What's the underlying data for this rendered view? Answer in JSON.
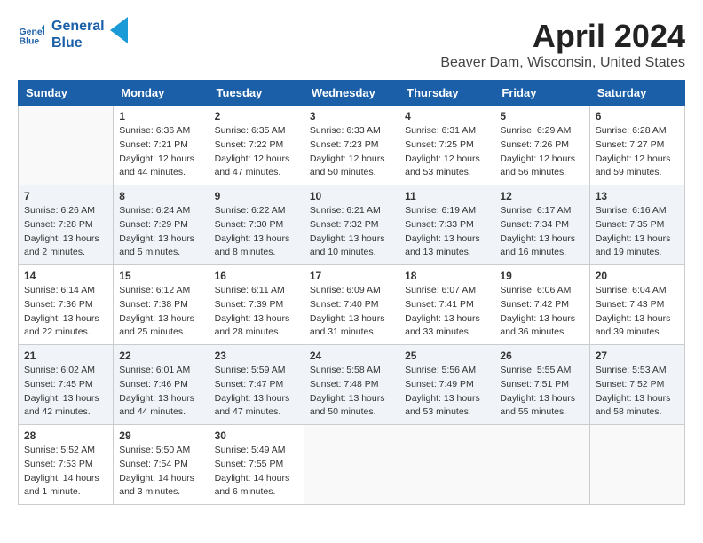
{
  "header": {
    "logo_line1": "General",
    "logo_line2": "Blue",
    "month": "April 2024",
    "location": "Beaver Dam, Wisconsin, United States"
  },
  "weekdays": [
    "Sunday",
    "Monday",
    "Tuesday",
    "Wednesday",
    "Thursday",
    "Friday",
    "Saturday"
  ],
  "weeks": [
    [
      {
        "day": "",
        "info": ""
      },
      {
        "day": "1",
        "info": "Sunrise: 6:36 AM\nSunset: 7:21 PM\nDaylight: 12 hours\nand 44 minutes."
      },
      {
        "day": "2",
        "info": "Sunrise: 6:35 AM\nSunset: 7:22 PM\nDaylight: 12 hours\nand 47 minutes."
      },
      {
        "day": "3",
        "info": "Sunrise: 6:33 AM\nSunset: 7:23 PM\nDaylight: 12 hours\nand 50 minutes."
      },
      {
        "day": "4",
        "info": "Sunrise: 6:31 AM\nSunset: 7:25 PM\nDaylight: 12 hours\nand 53 minutes."
      },
      {
        "day": "5",
        "info": "Sunrise: 6:29 AM\nSunset: 7:26 PM\nDaylight: 12 hours\nand 56 minutes."
      },
      {
        "day": "6",
        "info": "Sunrise: 6:28 AM\nSunset: 7:27 PM\nDaylight: 12 hours\nand 59 minutes."
      }
    ],
    [
      {
        "day": "7",
        "info": "Sunrise: 6:26 AM\nSunset: 7:28 PM\nDaylight: 13 hours\nand 2 minutes."
      },
      {
        "day": "8",
        "info": "Sunrise: 6:24 AM\nSunset: 7:29 PM\nDaylight: 13 hours\nand 5 minutes."
      },
      {
        "day": "9",
        "info": "Sunrise: 6:22 AM\nSunset: 7:30 PM\nDaylight: 13 hours\nand 8 minutes."
      },
      {
        "day": "10",
        "info": "Sunrise: 6:21 AM\nSunset: 7:32 PM\nDaylight: 13 hours\nand 10 minutes."
      },
      {
        "day": "11",
        "info": "Sunrise: 6:19 AM\nSunset: 7:33 PM\nDaylight: 13 hours\nand 13 minutes."
      },
      {
        "day": "12",
        "info": "Sunrise: 6:17 AM\nSunset: 7:34 PM\nDaylight: 13 hours\nand 16 minutes."
      },
      {
        "day": "13",
        "info": "Sunrise: 6:16 AM\nSunset: 7:35 PM\nDaylight: 13 hours\nand 19 minutes."
      }
    ],
    [
      {
        "day": "14",
        "info": "Sunrise: 6:14 AM\nSunset: 7:36 PM\nDaylight: 13 hours\nand 22 minutes."
      },
      {
        "day": "15",
        "info": "Sunrise: 6:12 AM\nSunset: 7:38 PM\nDaylight: 13 hours\nand 25 minutes."
      },
      {
        "day": "16",
        "info": "Sunrise: 6:11 AM\nSunset: 7:39 PM\nDaylight: 13 hours\nand 28 minutes."
      },
      {
        "day": "17",
        "info": "Sunrise: 6:09 AM\nSunset: 7:40 PM\nDaylight: 13 hours\nand 31 minutes."
      },
      {
        "day": "18",
        "info": "Sunrise: 6:07 AM\nSunset: 7:41 PM\nDaylight: 13 hours\nand 33 minutes."
      },
      {
        "day": "19",
        "info": "Sunrise: 6:06 AM\nSunset: 7:42 PM\nDaylight: 13 hours\nand 36 minutes."
      },
      {
        "day": "20",
        "info": "Sunrise: 6:04 AM\nSunset: 7:43 PM\nDaylight: 13 hours\nand 39 minutes."
      }
    ],
    [
      {
        "day": "21",
        "info": "Sunrise: 6:02 AM\nSunset: 7:45 PM\nDaylight: 13 hours\nand 42 minutes."
      },
      {
        "day": "22",
        "info": "Sunrise: 6:01 AM\nSunset: 7:46 PM\nDaylight: 13 hours\nand 44 minutes."
      },
      {
        "day": "23",
        "info": "Sunrise: 5:59 AM\nSunset: 7:47 PM\nDaylight: 13 hours\nand 47 minutes."
      },
      {
        "day": "24",
        "info": "Sunrise: 5:58 AM\nSunset: 7:48 PM\nDaylight: 13 hours\nand 50 minutes."
      },
      {
        "day": "25",
        "info": "Sunrise: 5:56 AM\nSunset: 7:49 PM\nDaylight: 13 hours\nand 53 minutes."
      },
      {
        "day": "26",
        "info": "Sunrise: 5:55 AM\nSunset: 7:51 PM\nDaylight: 13 hours\nand 55 minutes."
      },
      {
        "day": "27",
        "info": "Sunrise: 5:53 AM\nSunset: 7:52 PM\nDaylight: 13 hours\nand 58 minutes."
      }
    ],
    [
      {
        "day": "28",
        "info": "Sunrise: 5:52 AM\nSunset: 7:53 PM\nDaylight: 14 hours\nand 1 minute."
      },
      {
        "day": "29",
        "info": "Sunrise: 5:50 AM\nSunset: 7:54 PM\nDaylight: 14 hours\nand 3 minutes."
      },
      {
        "day": "30",
        "info": "Sunrise: 5:49 AM\nSunset: 7:55 PM\nDaylight: 14 hours\nand 6 minutes."
      },
      {
        "day": "",
        "info": ""
      },
      {
        "day": "",
        "info": ""
      },
      {
        "day": "",
        "info": ""
      },
      {
        "day": "",
        "info": ""
      }
    ]
  ]
}
